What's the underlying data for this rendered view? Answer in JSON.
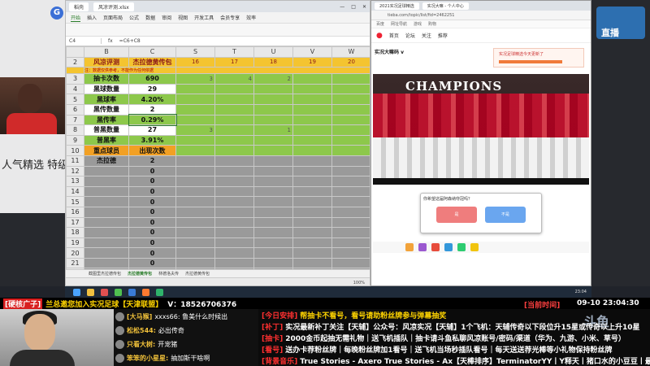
{
  "excel": {
    "tabs": [
      "稻壳",
      "风凉评测.xlsx"
    ],
    "ribbon": [
      "开始",
      "插入",
      "页面布局",
      "公式",
      "数据",
      "审阅",
      "视图",
      "开发工具",
      "会员专享",
      "效率"
    ],
    "active_ribbon": "开始",
    "formula": {
      "cell": "C4",
      "expr": "=C6+C8"
    },
    "col_headers": [
      "B",
      "C",
      "S",
      "T",
      "U",
      "V",
      "W"
    ],
    "header_row": {
      "row": "2",
      "label": "风凉评测",
      "value": "杰拉德黄传包",
      "extra": [
        "16",
        "17",
        "18",
        "19",
        "20"
      ]
    },
    "note_row": {
      "text": "注：数据仅供参考，不能作为任何依据"
    },
    "rows": [
      {
        "row": "3",
        "label": "抽卡次数",
        "value": "690",
        "style": "green",
        "extra": [
          "",
          "3",
          "4",
          "2",
          "",
          ""
        ]
      },
      {
        "row": "4",
        "label": "黑球数量",
        "value": "29",
        "style": "white",
        "extra": [
          "",
          "",
          "",
          "",
          "",
          ""
        ]
      },
      {
        "row": "5",
        "label": "黑球率",
        "value": "4.20%",
        "style": "green",
        "extra": [
          "",
          "",
          "",
          "",
          "",
          ""
        ]
      },
      {
        "row": "6",
        "label": "黑传数量",
        "value": "2",
        "style": "white",
        "extra": [
          "",
          "",
          "",
          "",
          "",
          ""
        ]
      },
      {
        "row": "7",
        "label": "黑传率",
        "value": "0.29%",
        "style": "green",
        "extra": [
          "",
          "",
          "",
          "",
          "",
          ""
        ]
      },
      {
        "row": "8",
        "label": "普黑数量",
        "value": "27",
        "style": "white",
        "extra": [
          "",
          "3",
          "",
          "1",
          "",
          ""
        ]
      },
      {
        "row": "9",
        "label": "普黑率",
        "value": "3.91%",
        "style": "green",
        "extra": [
          "",
          "",
          "",
          "",
          "",
          ""
        ]
      },
      {
        "row": "10",
        "label": "重点球员",
        "value": "出现次数",
        "style": "orange",
        "extra": [
          "",
          "",
          "",
          "",
          "",
          ""
        ]
      },
      {
        "row": "11",
        "label": "杰拉德",
        "value": "2",
        "style": "gray",
        "extra": [
          "",
          "",
          "",
          "",
          "",
          ""
        ]
      },
      {
        "row": "12",
        "label": "",
        "value": "0",
        "style": "gray",
        "extra": [
          "",
          "",
          "",
          "",
          "",
          ""
        ]
      },
      {
        "row": "13",
        "label": "",
        "value": "0",
        "style": "gray",
        "extra": [
          "",
          "",
          "",
          "",
          "",
          ""
        ]
      },
      {
        "row": "14",
        "label": "",
        "value": "0",
        "style": "gray",
        "extra": [
          "",
          "",
          "",
          "",
          "",
          ""
        ]
      },
      {
        "row": "15",
        "label": "",
        "value": "0",
        "style": "gray",
        "extra": [
          "",
          "",
          "",
          "",
          "",
          ""
        ]
      },
      {
        "row": "16",
        "label": "",
        "value": "0",
        "style": "gray",
        "extra": [
          "",
          "",
          "",
          "",
          "",
          ""
        ]
      },
      {
        "row": "17",
        "label": "",
        "value": "0",
        "style": "gray",
        "extra": [
          "",
          "",
          "",
          "",
          "",
          ""
        ]
      },
      {
        "row": "18",
        "label": "",
        "value": "0",
        "style": "gray",
        "extra": [
          "",
          "",
          "",
          "",
          "",
          ""
        ]
      },
      {
        "row": "19",
        "label": "",
        "value": "0",
        "style": "gray",
        "extra": [
          "",
          "",
          "",
          "",
          "",
          ""
        ]
      },
      {
        "row": "20",
        "label": "",
        "value": "0",
        "style": "gray",
        "extra": [
          "",
          "",
          "",
          "",
          "",
          ""
        ]
      },
      {
        "row": "21",
        "label": "",
        "value": "0",
        "style": "gray",
        "extra": [
          "",
          "",
          "",
          "",
          "",
          ""
        ]
      },
      {
        "row": "22",
        "label": "",
        "value": "0",
        "style": "gray",
        "extra": [
          "",
          "",
          "",
          "",
          "",
          ""
        ]
      },
      {
        "row": "23",
        "label": "",
        "value": "0",
        "style": "gray",
        "extra": [
          "",
          "",
          "",
          "",
          "",
          ""
        ]
      }
    ],
    "sheet_tabs": [
      "截图里杰拉德传包",
      "杰拉德黄传包",
      "林德洛夫传",
      "杰拉德黄传包"
    ],
    "active_sheet": "杰拉德黄传包",
    "zoom": "100%"
  },
  "browser": {
    "tabs": [
      "2021实况足球精选",
      "实况大嘛 - 个人中心"
    ],
    "url": "tieba.com/topic/list/fid=2462251",
    "bookmarks": [
      "百度",
      "网址导航",
      "游戏",
      "购物"
    ],
    "site_nav": [
      "首页",
      "论坛",
      "关注",
      "推荐"
    ],
    "post_title": "实况大嘛码 v",
    "notice_text": "实况足球精选今天更新了",
    "photo_banner": "CHAMPIONS",
    "poll_question": "你希望这届阿森纳夺冠吗？",
    "poll_options": [
      "是",
      "不是"
    ]
  },
  "left_promo": "人气精选 特级",
  "right_label": "直播",
  "taskbar_clock": "23:04",
  "overlay": {
    "top_tag": "[硬核广子]",
    "top_msg": "兰总邀您加入实况足球【天津联盟】",
    "top_contact": "V：18526706376",
    "time_label": "[当前时间]",
    "time_value": "09-10  23:04:30"
  },
  "chat": [
    {
      "name": "[大马猴]",
      "text": "xxxs66: 鲁美什么时候出"
    },
    {
      "name": "松松544:",
      "text": "必出传奇"
    },
    {
      "name": "只看大树:",
      "text": "开宠猪"
    },
    {
      "name": "笨笨的小星星:",
      "text": "抽加斯干啥啊"
    }
  ],
  "notices": [
    {
      "k": "[今日安排]",
      "t": "帮抽卡不看号，看号请助粉丝牌参与弹幕抽奖",
      "style": "y"
    },
    {
      "k": "[补丁]",
      "t": "实况最新补丁关注【天辅】公众号：风凉实况【天辅】1个飞机：天辅传奇以下段位升15星或传奇以上升10星",
      "style": "t"
    },
    {
      "k": "[抽卡]",
      "t": "2000金币起抽无需礼物｜送飞机插队｜抽卡请斗鱼私聊风凉账号/密码/渠道（华为、九游、小米、草号）",
      "style": "t"
    },
    {
      "k": "[看号]",
      "t": "送办卡荐粉丝牌｜每晚粉丝牌加1看号｜送飞机当场秒插队看号｜每天送送荐光棒等小礼物保持粉丝牌",
      "style": "t"
    },
    {
      "k": "[背景音乐]",
      "t": "True Stories - Axero True Stories - Ax【天棒排序】TerminatorYY丨Y释天丨猪口水的小豆豆丨最~",
      "style": "t"
    }
  ],
  "brand": "斗鱼"
}
